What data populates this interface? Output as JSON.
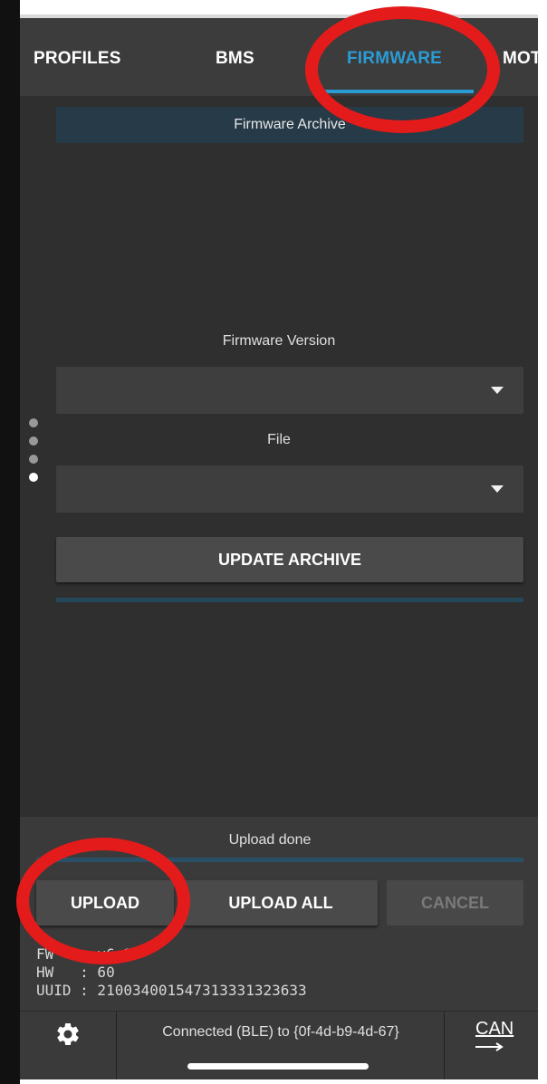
{
  "tabs": [
    {
      "label": "PROFILES"
    },
    {
      "label": "BMS"
    },
    {
      "label": "FIRMWARE"
    },
    {
      "label": "MOT"
    }
  ],
  "active_tab": "FIRMWARE",
  "firmware": {
    "archive_header": "Firmware Archive",
    "version_label": "Firmware Version",
    "version_value": "",
    "file_label": "File",
    "file_value": "",
    "update_archive_button": "UPDATE ARCHIVE"
  },
  "page_indicator": {
    "pages": 4,
    "active": 4
  },
  "upload": {
    "status": "Upload done",
    "upload_button": "UPLOAD",
    "upload_all_button": "UPLOAD ALL",
    "cancel_button": "CANCEL"
  },
  "device_info": {
    "fw_line": "FW   : v6.2",
    "hw_line": "HW   : 60",
    "uuid_line": "UUID : 210034001547313331323633"
  },
  "status_bar": {
    "settings_icon": "gear-icon",
    "connection_text": "Connected (BLE) to {0f-4d-b9-4d-67}",
    "can_label": "CAN",
    "can_icon": "arrow-right-icon"
  },
  "colors": {
    "accent": "#2b9bd3",
    "annotation": "#e41b1b",
    "background": "#2f2f2f"
  }
}
